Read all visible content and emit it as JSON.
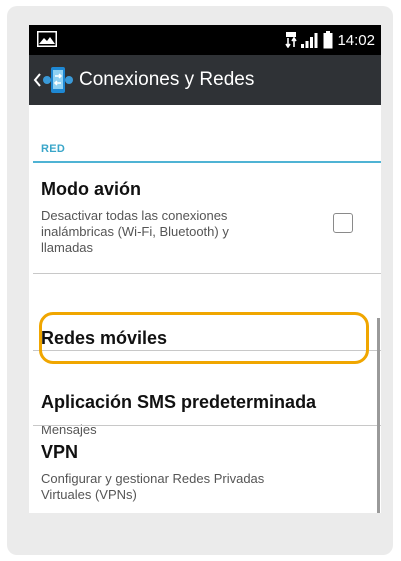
{
  "status_bar": {
    "time": "14:02",
    "left_icon": "image-notification-icon",
    "right_icons": [
      "data-transfer-icon",
      "signal-icon",
      "battery-icon"
    ]
  },
  "action_bar": {
    "title": "Conexiones y Redes",
    "icon": "connections-app-icon"
  },
  "section": {
    "header": "RED"
  },
  "items": [
    {
      "title": "Modo avión",
      "subtitle_lines": [
        "Desactivar todas las conexiones",
        "inalámbricas (Wi-Fi, Bluetooth) y",
        "llamadas"
      ],
      "checked": false
    },
    {
      "title": "Redes móviles",
      "highlighted": true
    },
    {
      "title": "Aplicación SMS predeterminada",
      "subtitle_lines": [
        "Mensajes"
      ]
    },
    {
      "title": "VPN",
      "subtitle_lines": [
        "Configurar y gestionar Redes Privadas",
        "Virtuales (VPNs)"
      ]
    }
  ],
  "colors": {
    "accent": "#4fb3d4",
    "highlight": "#f0a600",
    "action_bar": "#2f3236",
    "status_bar": "#000000"
  }
}
